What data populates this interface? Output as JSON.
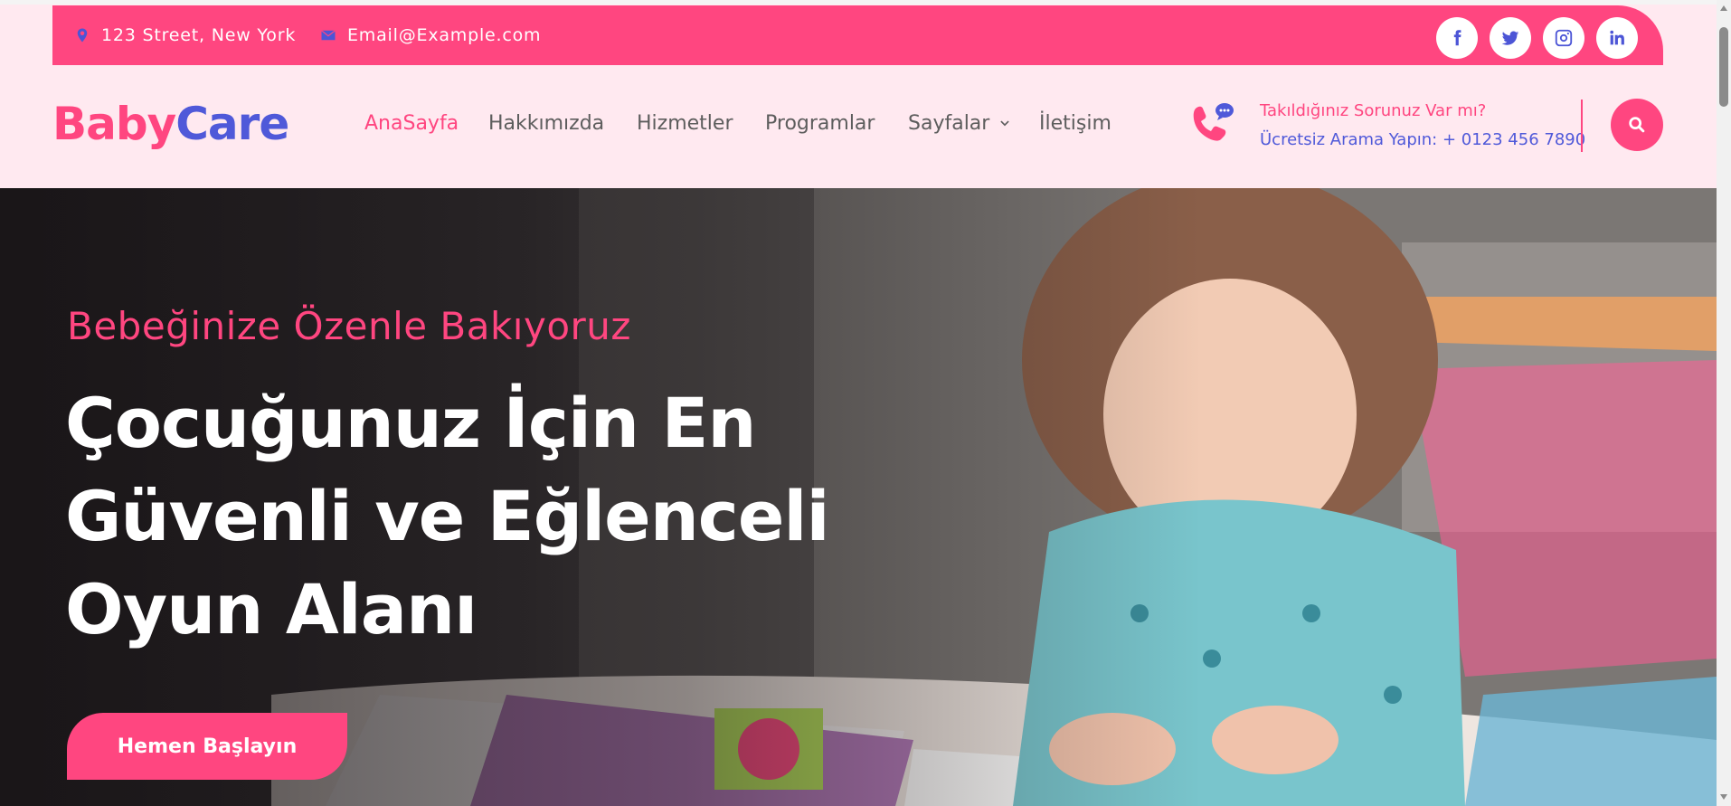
{
  "topbar": {
    "address": "123 Street, New York",
    "email": "Email@Example.com",
    "socials": [
      "facebook-icon",
      "twitter-icon",
      "instagram-icon",
      "linkedin-icon"
    ]
  },
  "logo": {
    "part1": "Baby",
    "part2": "Care"
  },
  "nav": {
    "items": [
      "AnaSayfa",
      "Hakkımızda",
      "Hizmetler",
      "Programlar",
      "Sayfalar",
      "İletişim"
    ],
    "active": "AnaSayfa"
  },
  "contact": {
    "question": "Takıldığınız Sorunuz Var mı?",
    "call": "Ücretsiz Arama Yapın: + 0123 456 7890"
  },
  "hero": {
    "subtitle": "Bebeğinize Özenle Bakıyoruz",
    "title_lines": [
      "Çocuğunuz İçin En",
      "Güvenli ve Eğlenceli",
      "Oyun Alanı"
    ],
    "cta": "Hemen Başlayın"
  },
  "colors": {
    "accent": "#ff4680",
    "secondary": "#4f59d9",
    "header_bg": "#ffe9f0"
  }
}
